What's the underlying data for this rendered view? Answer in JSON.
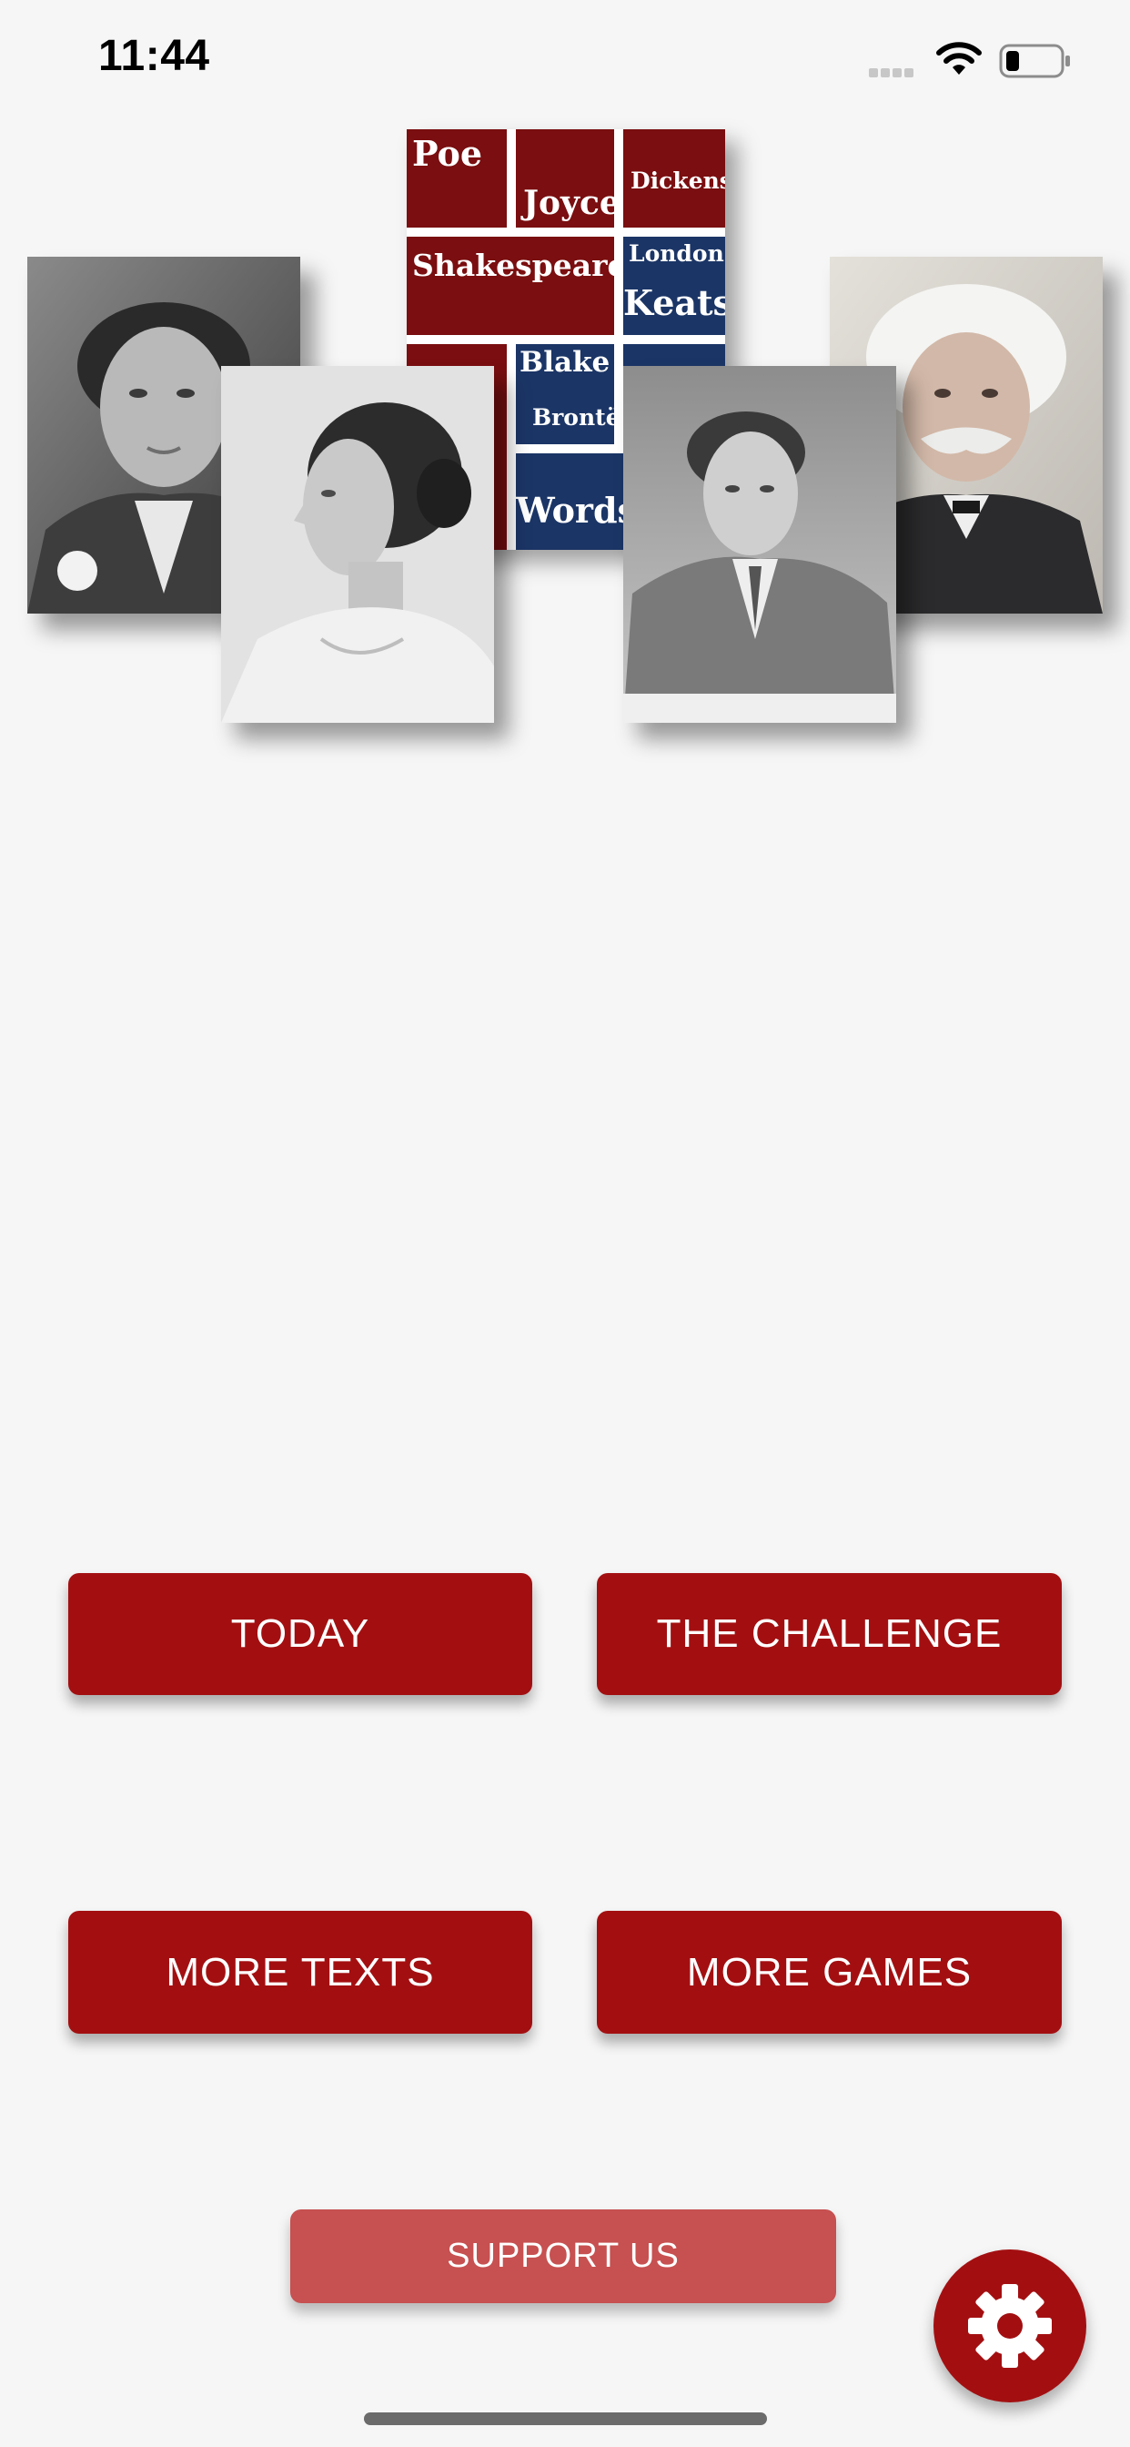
{
  "status_bar": {
    "time": "11:44"
  },
  "word_cloud": {
    "words": [
      "Poe",
      "Joyce",
      "Dickens",
      "Shakespeare",
      "London",
      "Keats",
      "Blake",
      "Brontë",
      "Words"
    ],
    "colors": {
      "red": "#7a0e10",
      "blue": "#1b3566"
    }
  },
  "portraits": [
    {
      "name": "portrait-woman-left"
    },
    {
      "name": "portrait-woman-profile"
    },
    {
      "name": "portrait-man-suit"
    },
    {
      "name": "portrait-man-white-hair"
    }
  ],
  "menu": {
    "today": "TODAY",
    "challenge": "THE CHALLENGE",
    "more_texts": "MORE TEXTS",
    "more_games": "MORE GAMES",
    "support": "SUPPORT US"
  },
  "icons": {
    "settings": "gear-icon",
    "wifi": "wifi-icon",
    "battery": "battery-icon",
    "signal": "signal-icon"
  },
  "colors": {
    "primary": "#a30f11",
    "support": "#c75050",
    "background": "#f6f6f6"
  }
}
